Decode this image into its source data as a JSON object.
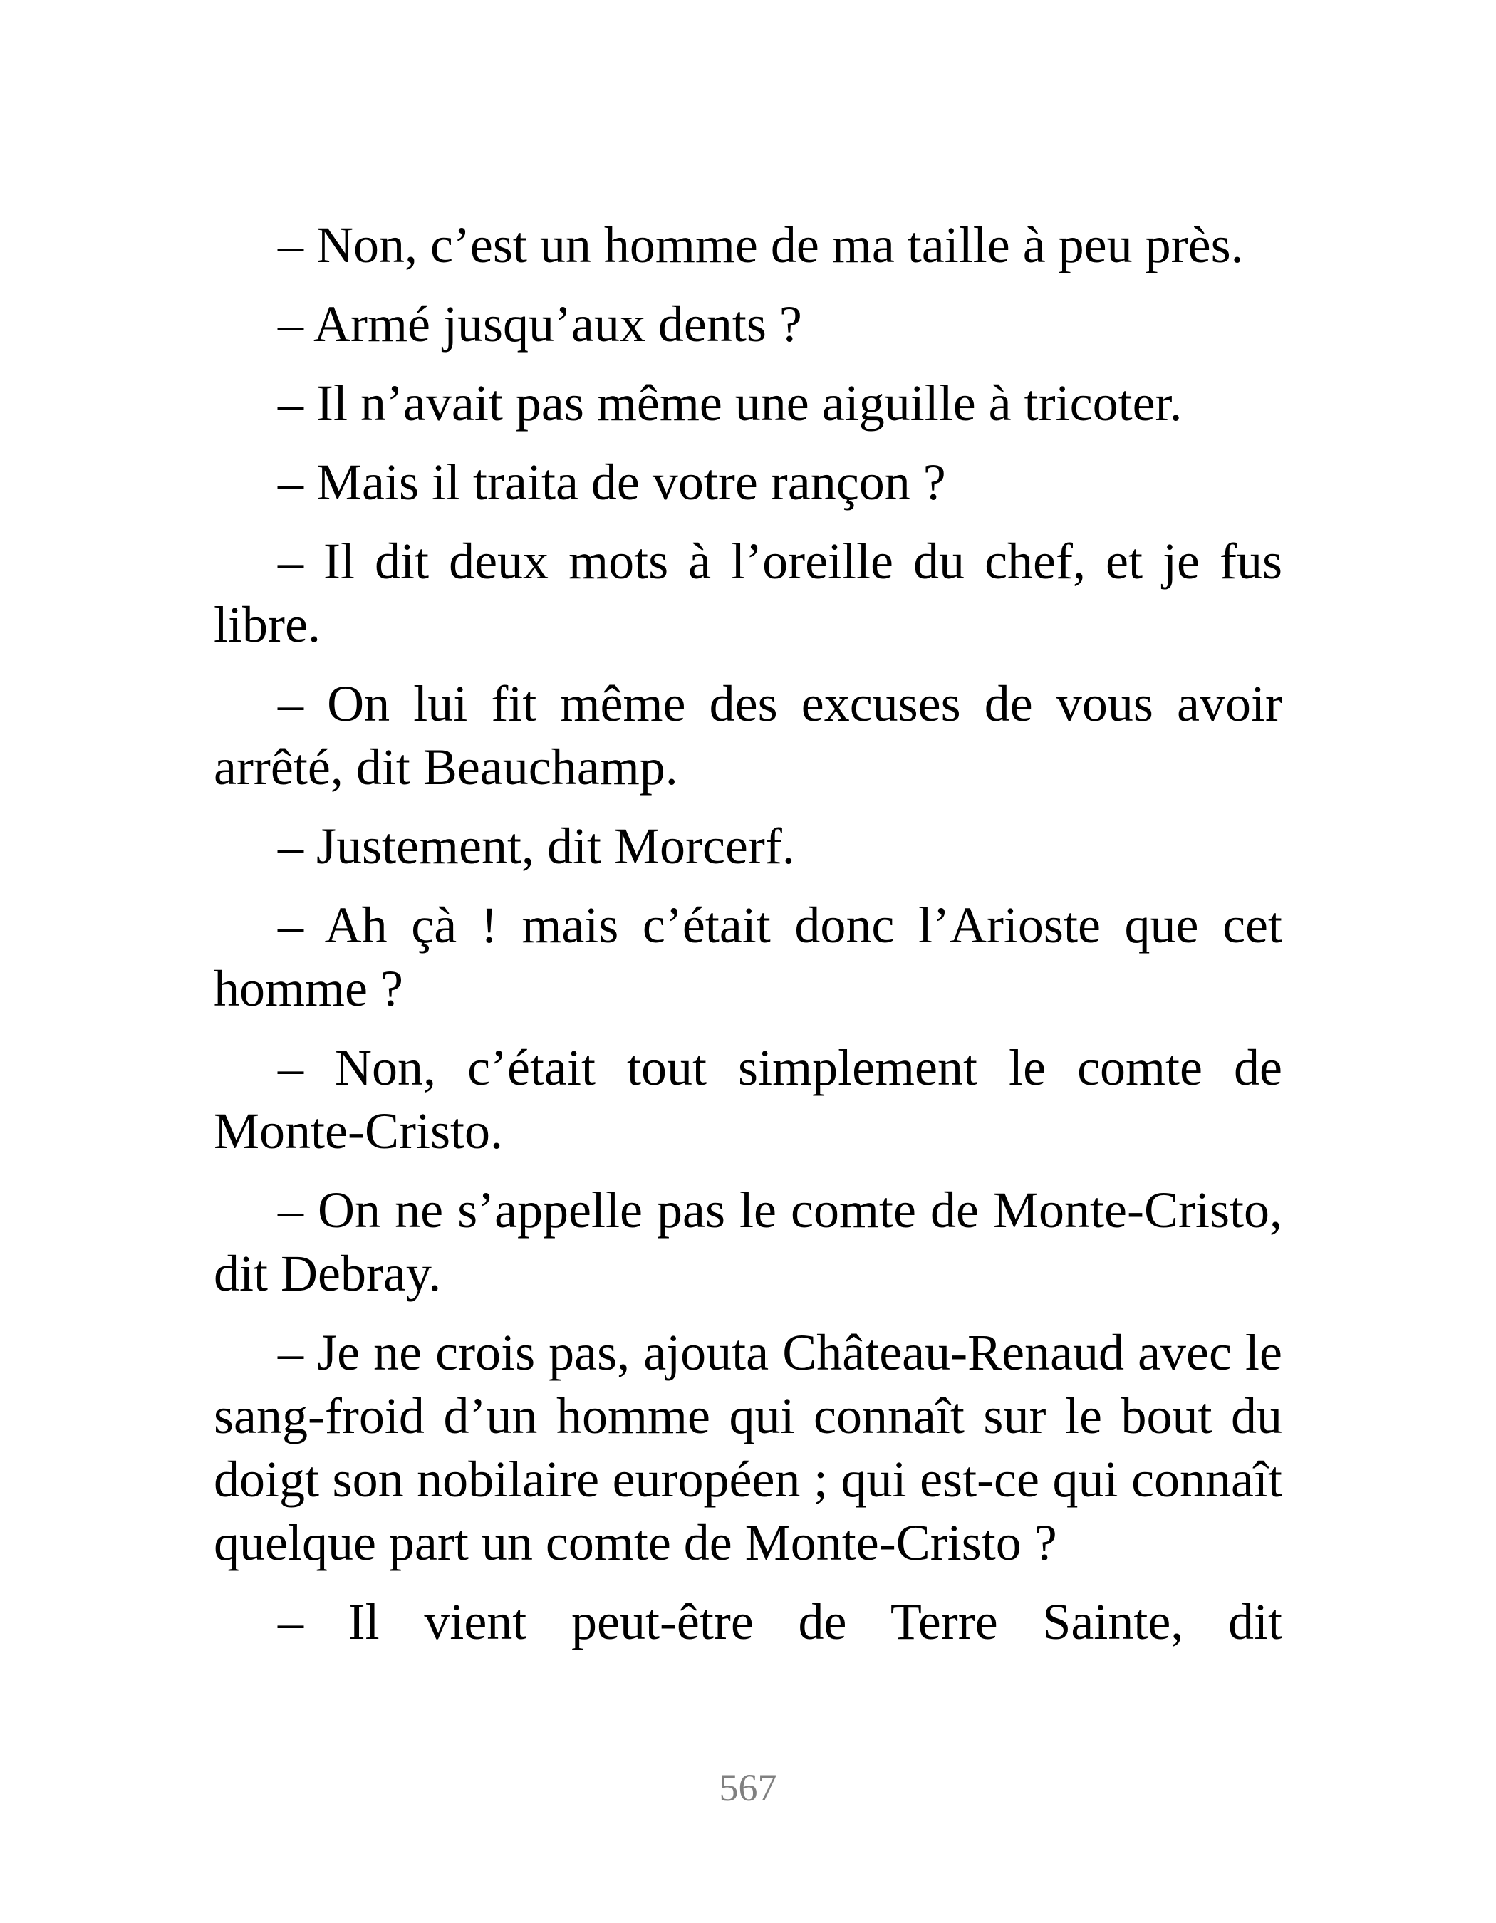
{
  "document": {
    "paragraphs": [
      "– Non, c’est un homme de ma taille à peu près.",
      "– Armé jusqu’aux dents ?",
      "– Il n’avait pas même une aiguille à tricoter.",
      "– Mais il traita de votre rançon ?",
      "– Il dit deux mots à l’oreille du chef, et je fus libre.",
      "– On lui fit même des excuses de vous avoir arrêté, dit Beauchamp.",
      "– Justement, dit Morcerf.",
      "– Ah çà ! mais c’était donc l’Arioste que cet homme ?",
      "– Non, c’était tout simplement le comte de Monte-Cristo.",
      "– On ne s’appelle pas le comte de Monte-Cristo, dit Debray.",
      "– Je ne crois pas, ajouta Château-Renaud avec le sang-froid d’un homme qui connaît sur le bout du doigt son nobilaire européen ; qui est-ce qui connaît quelque part un comte de Monte-Cristo ?",
      "– Il vient peut-être de Terre Sainte, dit"
    ],
    "page_number": "567"
  }
}
